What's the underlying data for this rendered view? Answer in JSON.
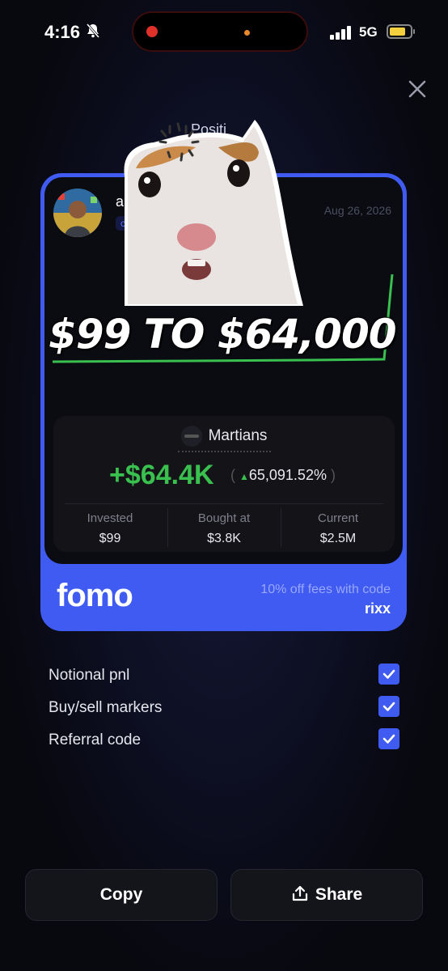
{
  "status_bar": {
    "time": "4:16",
    "network": "5G"
  },
  "sheet_title": "Positi",
  "card": {
    "user": {
      "name": "a",
      "handle_badge": "ct"
    },
    "date": "Aug 26, 2026",
    "meme_text": "$99 TO $64,000",
    "token": {
      "name": "Martians"
    },
    "pnl": {
      "value": "+$64.4K",
      "percent": "65,091.52%"
    },
    "metrics": [
      {
        "label": "Invested",
        "value": "$99"
      },
      {
        "label": "Bought at",
        "value": "$3.8K"
      },
      {
        "label": "Current",
        "value": "$2.5M"
      }
    ],
    "brand": "fomo",
    "promo": {
      "text": "10% off fees with code",
      "code": "rixx"
    }
  },
  "options": [
    {
      "label": "Notional pnl",
      "checked": true
    },
    {
      "label": "Buy/sell markers",
      "checked": true
    },
    {
      "label": "Referral code",
      "checked": true
    }
  ],
  "actions": {
    "copy_label": "Copy",
    "share_label": "Share"
  },
  "colors": {
    "accent": "#3f5bf2",
    "positive": "#39c04f",
    "background": "#0a0a14"
  }
}
